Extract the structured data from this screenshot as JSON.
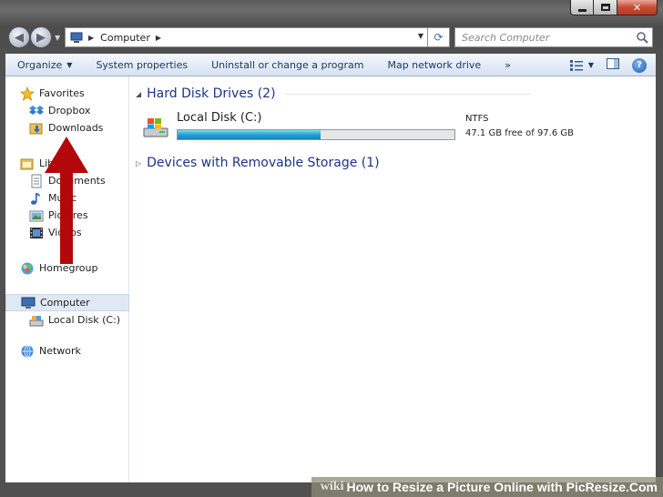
{
  "navigation": {
    "address_path": "Computer",
    "search_placeholder": "Search Computer"
  },
  "toolbar": {
    "organize": "Organize",
    "system_properties": "System properties",
    "uninstall": "Uninstall or change a program",
    "map_drive": "Map network drive",
    "overflow": "»"
  },
  "sidebar": {
    "favorites": "Favorites",
    "dropbox": "Dropbox",
    "downloads": "Downloads",
    "libraries": "Libraries",
    "documents": "Documents",
    "music": "Music",
    "pictures": "Pictures",
    "videos": "Videos",
    "homegroup": "Homegroup",
    "computer": "Computer",
    "local_disk": "Local Disk (C:)",
    "network": "Network"
  },
  "main": {
    "hard_disk_group": "Hard Disk Drives (2)",
    "removable_group": "Devices with Removable Storage (1)",
    "drive": {
      "name": "Local Disk (C:)",
      "filesystem": "NTFS",
      "free_text": "47.1 GB free of 97.6 GB",
      "used_fraction": 0.517
    }
  },
  "watermark": {
    "brand": "wiki",
    "title": "How to Resize a Picture Online with PicResize.Com"
  },
  "colors": {
    "annotation_arrow": "#b3080b",
    "progress_fill": "#26a0da",
    "group_header": "#1e3287"
  }
}
